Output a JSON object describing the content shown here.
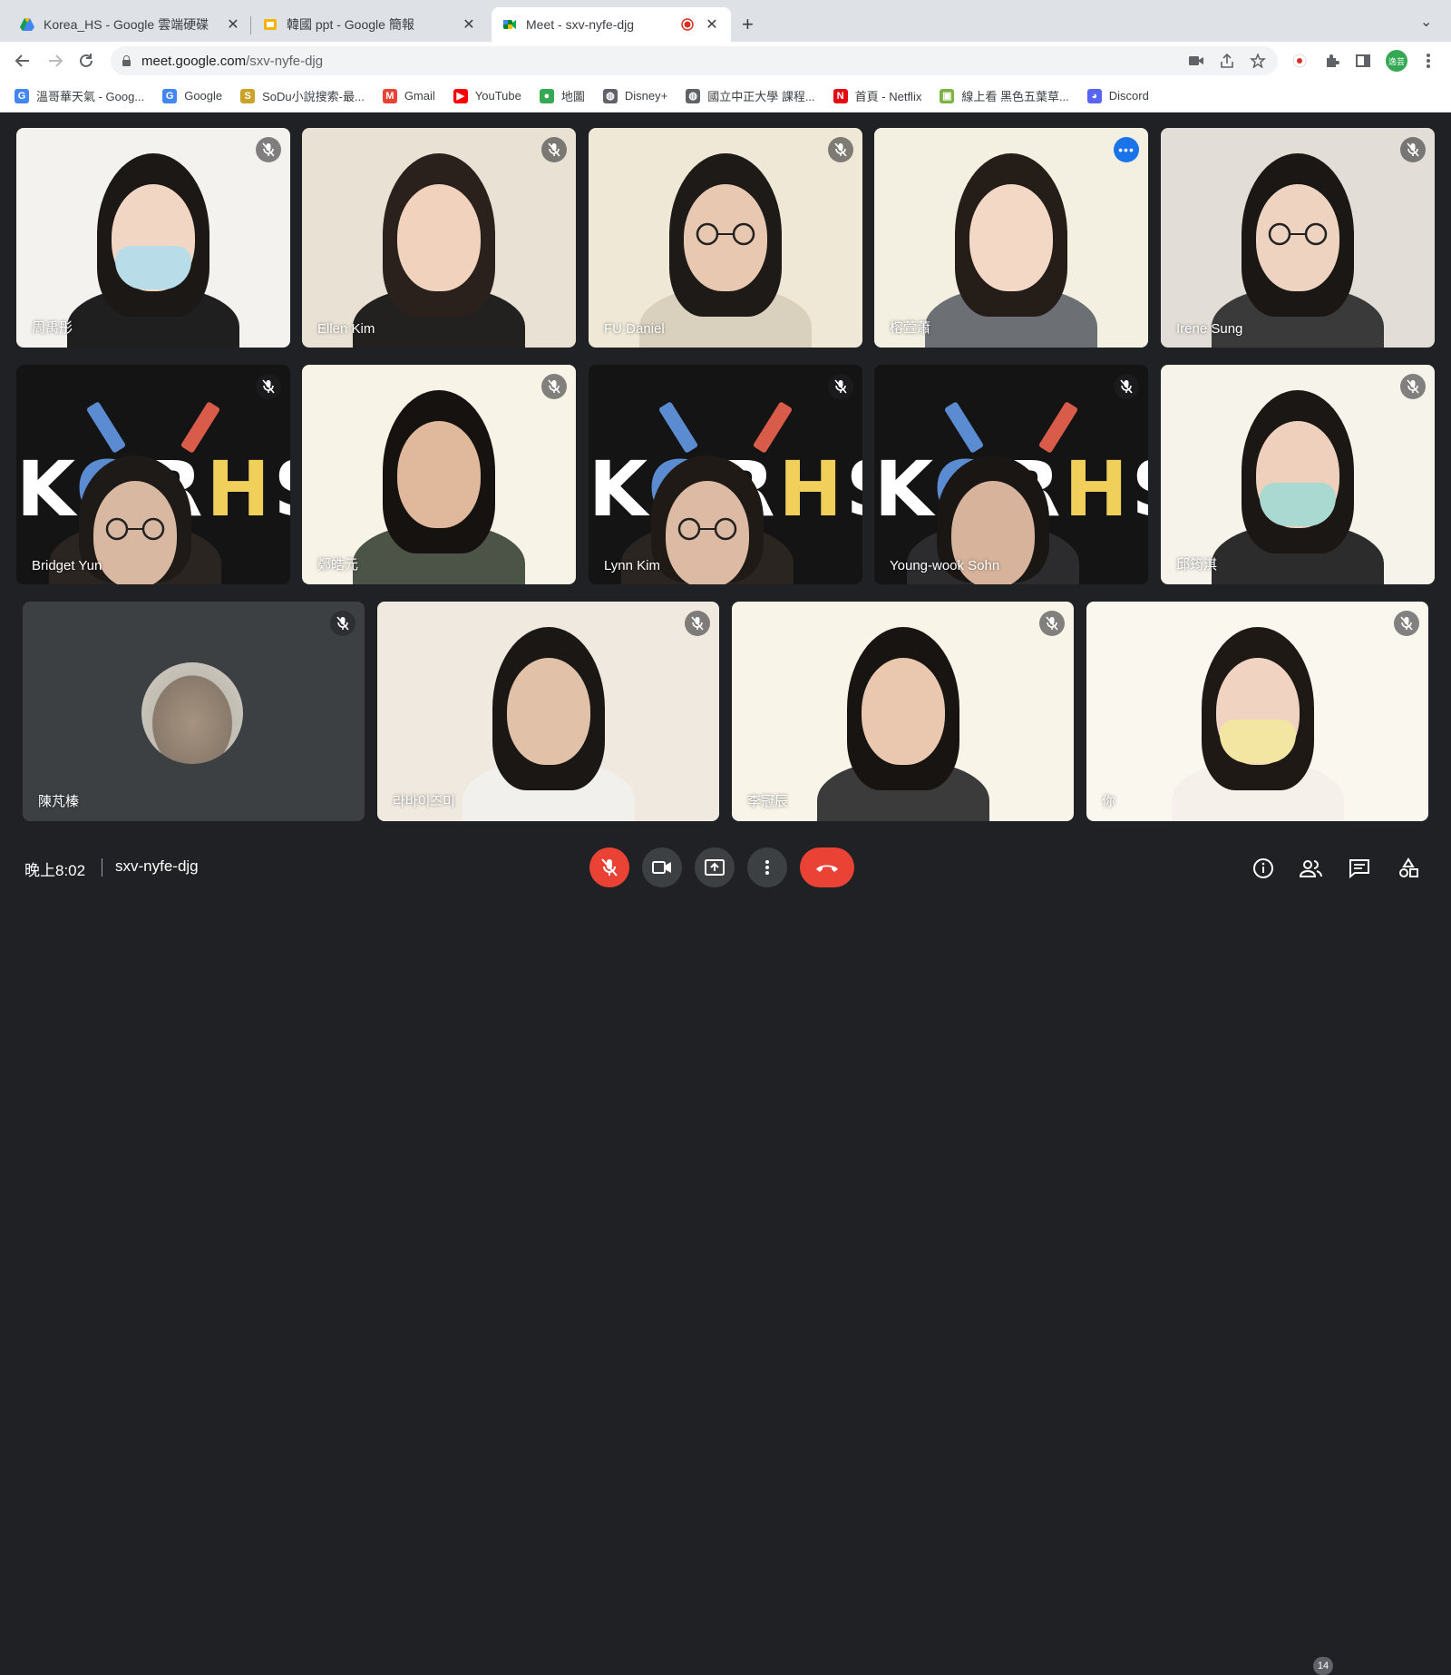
{
  "tabs": [
    {
      "title": "Korea_HS - Google 雲端硬碟",
      "close": "✕",
      "icon": "google-drive-icon",
      "color": "#1a73e8"
    },
    {
      "title": "韓國 ppt - Google 簡報",
      "close": "✕",
      "icon": "google-slides-icon",
      "color": "#f4b400"
    },
    {
      "title": "Meet - sxv-nyfe-djg",
      "close": "✕",
      "icon": "google-meet-icon",
      "color": "#00832d"
    }
  ],
  "newtab_label": "+",
  "tab_menu_label": "⌄",
  "address": {
    "host": "meet.google.com",
    "path": "/sxv-nyfe-djg"
  },
  "profile_initials": "逸芸",
  "bookmarks": [
    {
      "label": "溫哥華天氣 - Goog...",
      "icon": "google-icon",
      "glyph": "G",
      "color": "#4285f4"
    },
    {
      "label": "Google",
      "icon": "google-icon",
      "glyph": "G",
      "color": "#4285f4"
    },
    {
      "label": "SoDu小說搜索-最...",
      "icon": "sodu-icon",
      "glyph": "S",
      "color": "#c9a227"
    },
    {
      "label": "Gmail",
      "icon": "gmail-icon",
      "glyph": "M",
      "color": "#ea4335"
    },
    {
      "label": "YouTube",
      "icon": "youtube-icon",
      "glyph": "▶",
      "color": "#ff0000"
    },
    {
      "label": "地圖",
      "icon": "maps-pin-icon",
      "glyph": "●",
      "color": "#34a853"
    },
    {
      "label": "Disney+",
      "icon": "globe-icon",
      "glyph": "◍",
      "color": "#5f6368"
    },
    {
      "label": "國立中正大學 課程...",
      "icon": "globe-icon",
      "glyph": "◍",
      "color": "#5f6368"
    },
    {
      "label": "首頁 - Netflix",
      "icon": "netflix-icon",
      "glyph": "N",
      "color": "#e50914"
    },
    {
      "label": "線上看 黑色五葉草...",
      "icon": "tv-site-icon",
      "glyph": "▣",
      "color": "#7cb342"
    },
    {
      "label": "Discord",
      "icon": "discord-icon",
      "glyph": "◕",
      "color": "#5865f2"
    }
  ],
  "participants": [
    {
      "name": "周禹彤",
      "muted": true
    },
    {
      "name": "Ellen Kim",
      "muted": true
    },
    {
      "name": "FU Daniel",
      "muted": true
    },
    {
      "name": "榕萱蕭",
      "muted": false,
      "speaking": true
    },
    {
      "name": "Irene Sung",
      "muted": true
    },
    {
      "name": "Bridget Yun",
      "muted": true
    },
    {
      "name": "鄭皓元",
      "muted": true
    },
    {
      "name": "Lynn Kim",
      "muted": true
    },
    {
      "name": "Young-wook Sohn",
      "muted": true
    },
    {
      "name": "邱筠淇",
      "muted": true
    },
    {
      "name": "陳芃榛",
      "muted": true
    },
    {
      "name": "라바이즈미",
      "muted": true
    },
    {
      "name": "李冠辰",
      "muted": true
    },
    {
      "name": "你",
      "muted": true
    }
  ],
  "background_logo": {
    "k": "K",
    "o": "O",
    "r": "R",
    "h": "H",
    "s": "S"
  },
  "colors": {
    "accent_blue": "#8ab4f8",
    "end_call_red": "#ea4335",
    "control_grey": "#3c4043"
  },
  "meeting": {
    "time": "晚上8:02",
    "code": "sxv-nyfe-djg"
  },
  "people_count": "14"
}
